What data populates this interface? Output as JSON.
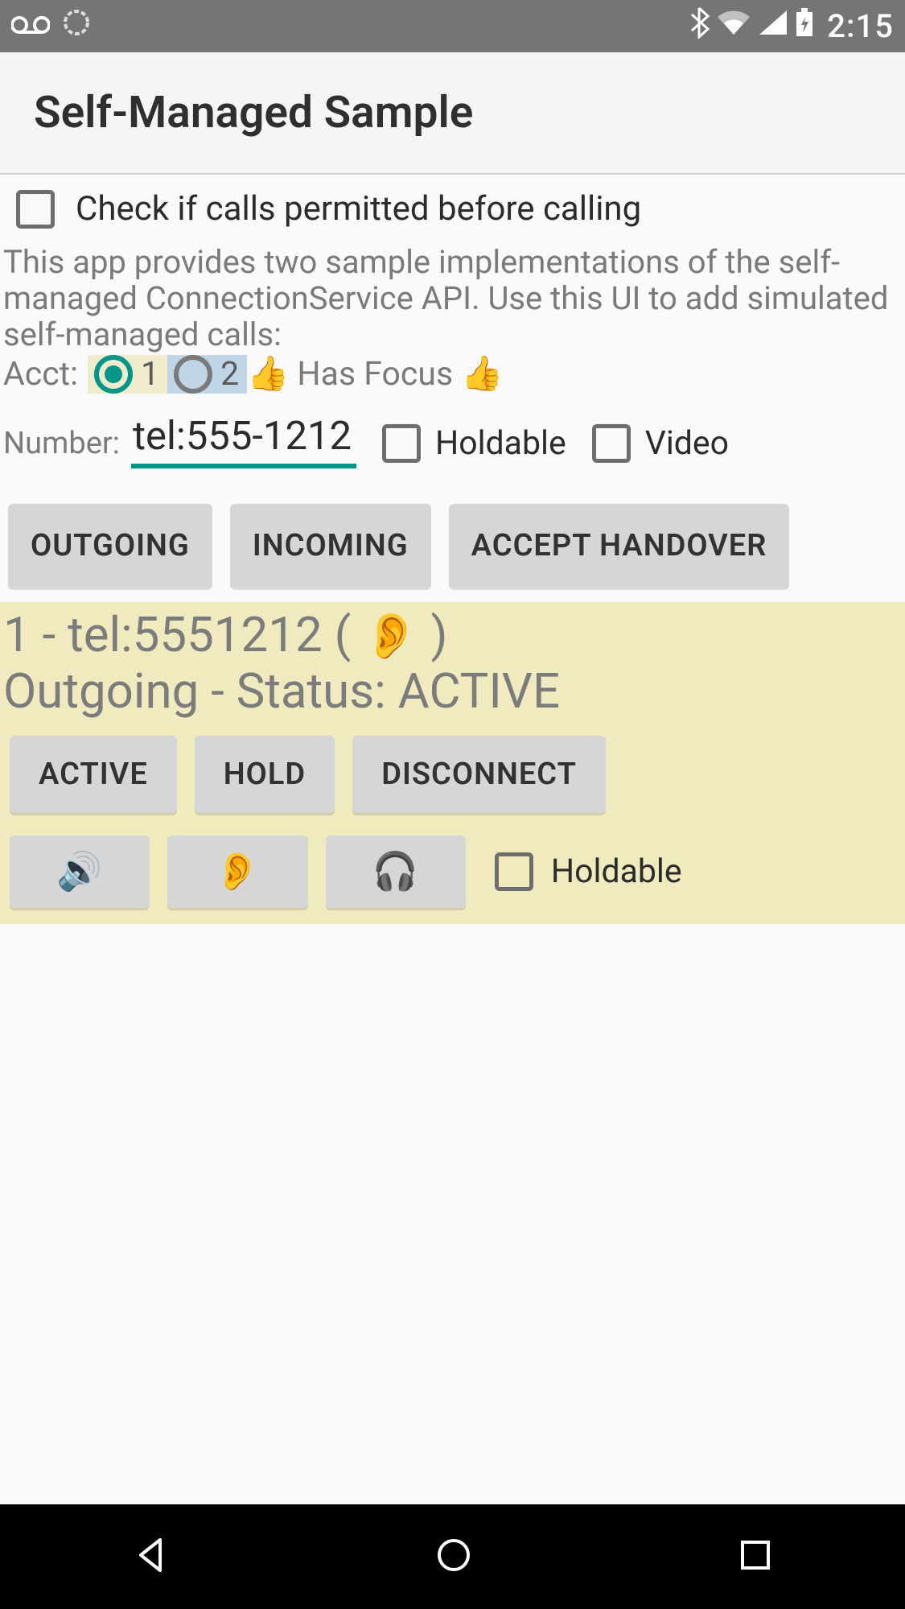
{
  "status_bar": {
    "time": "2:15",
    "icons": {
      "voicemail": "voicemail-icon",
      "sync": "sync-icon",
      "bluetooth": "bluetooth-icon",
      "wifi": "wifi-icon",
      "cell": "cell-signal-icon",
      "battery": "battery-charging-icon"
    }
  },
  "header": {
    "title": "Self-Managed Sample"
  },
  "permitted_checkbox": {
    "label": "Check if calls permitted before calling",
    "checked": false
  },
  "description": "This app provides two sample implementations of the self-managed ConnectionService API.  Use this UI to add simulated self-managed calls:",
  "acct": {
    "label": "Acct:",
    "options": [
      {
        "value": "1",
        "selected": true
      },
      {
        "value": "2",
        "selected": false
      }
    ],
    "focus_emoji": "👍",
    "focus_label": "Has Focus",
    "focus_emoji2": "👍"
  },
  "number": {
    "label": "Number:",
    "value": "tel:555-1212"
  },
  "holdable_top": {
    "label": "Holdable",
    "checked": false
  },
  "video_top": {
    "label": "Video",
    "checked": false
  },
  "buttons": {
    "outgoing": "OUTGOING",
    "incoming": "INCOMING",
    "accept_handover": "ACCEPT HANDOVER"
  },
  "call": {
    "line1_prefix": "1 - tel:5551212 ( ",
    "line1_emoji": "👂",
    "line1_suffix": " )",
    "line2": "Outgoing - Status: ACTIVE",
    "btn_active": "ACTIVE",
    "btn_hold": "HOLD",
    "btn_disconnect": "DISCONNECT",
    "btn_speaker_emoji": "🔊",
    "btn_earpiece_emoji": "👂",
    "btn_headset_emoji": "🎧",
    "holdable_label": "Holdable",
    "holdable_checked": false
  }
}
